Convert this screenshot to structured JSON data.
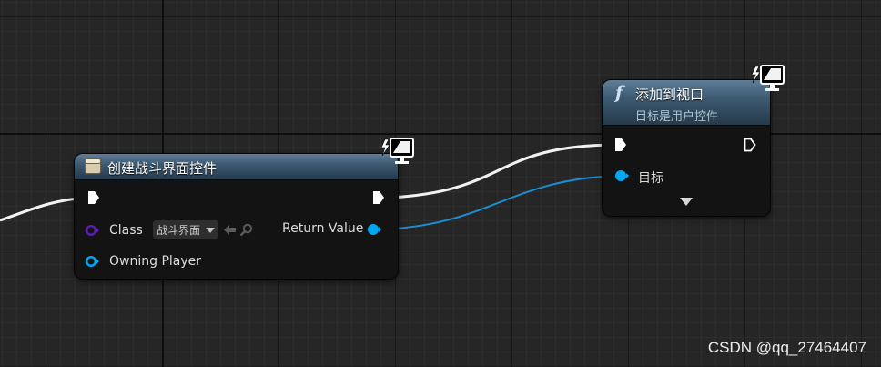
{
  "canvas": {
    "background": "#262626"
  },
  "nodes": {
    "create_widget": {
      "title": "创建战斗界面控件",
      "header_color": "#3d5a72",
      "icon": "widget-blueprint-icon",
      "pins": {
        "class_label": "Class",
        "class_value": "战斗界面",
        "owning_player_label": "Owning Player",
        "return_value_label": "Return Value"
      }
    },
    "add_to_viewport": {
      "title": "添加到视口",
      "subtitle": "目标是用户控件",
      "function_glyph": "f",
      "header_color": "#3d5a72",
      "pins": {
        "target_label": "目标"
      }
    }
  },
  "pin_colors": {
    "exec": "#ffffff",
    "class": "#5a1fb0",
    "object": "#00a8f0"
  },
  "watermark": "CSDN @qq_27464407"
}
